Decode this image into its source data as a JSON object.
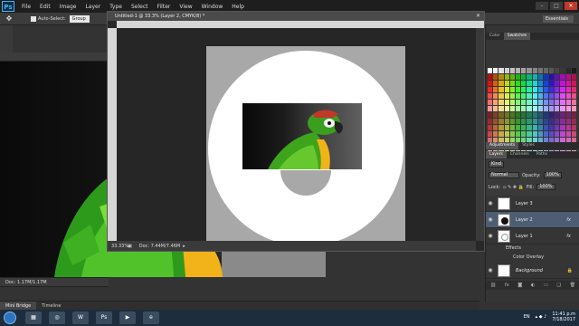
{
  "app": {
    "logo": "Ps"
  },
  "menu": [
    "File",
    "Edit",
    "Image",
    "Layer",
    "Type",
    "Select",
    "Filter",
    "View",
    "Window",
    "Help"
  ],
  "window_controls": [
    "–",
    "□",
    "✕"
  ],
  "options_bar": {
    "auto_select_label": "Auto-Select:",
    "auto_select_value": "Group",
    "workspace": "Essentials"
  },
  "background_doc": {
    "status": "Doc: 1.17M/1.17M"
  },
  "bottom_tabs": [
    "Mini Bridge",
    "Timeline"
  ],
  "document": {
    "title": "Untitled-1 @ 33.3% (Layer 2, CMYK/8) *",
    "zoom": "33.33%",
    "docsize": "Doc: 7.44M/7.46M"
  },
  "panels": {
    "color_tabs": [
      "Color",
      "Swatches"
    ],
    "adjust_tabs": [
      "Adjustments",
      "Styles"
    ],
    "layers_tabs": [
      "Layers",
      "Channels",
      "Paths"
    ],
    "kind_label": "Kind",
    "blend_mode": "Normal",
    "opacity_label": "Opacity:",
    "opacity_value": "100%",
    "lock_label": "Lock:",
    "fill_label": "Fill:",
    "fill_value": "100%",
    "layers": [
      {
        "name": "Layer 3"
      },
      {
        "name": "Layer 2",
        "fx": "fx"
      },
      {
        "name": "Layer 1",
        "fx": "fx"
      }
    ],
    "effects_label": "Effects",
    "color_overlay_label": "Color Overlay",
    "background_layer": "Background",
    "footer_icons": [
      "link-icon",
      "fx-icon",
      "mask-icon",
      "adjustment-icon",
      "folder-icon",
      "new-layer-icon",
      "trash-icon"
    ]
  },
  "taskbar": {
    "lang": "EN",
    "time": "11:41 p.m",
    "date": "7/18/2017",
    "apps": [
      "explorer-icon",
      "chrome-icon",
      "word-icon",
      "photoshop-icon",
      "media-icon",
      "iexplore-icon"
    ]
  }
}
